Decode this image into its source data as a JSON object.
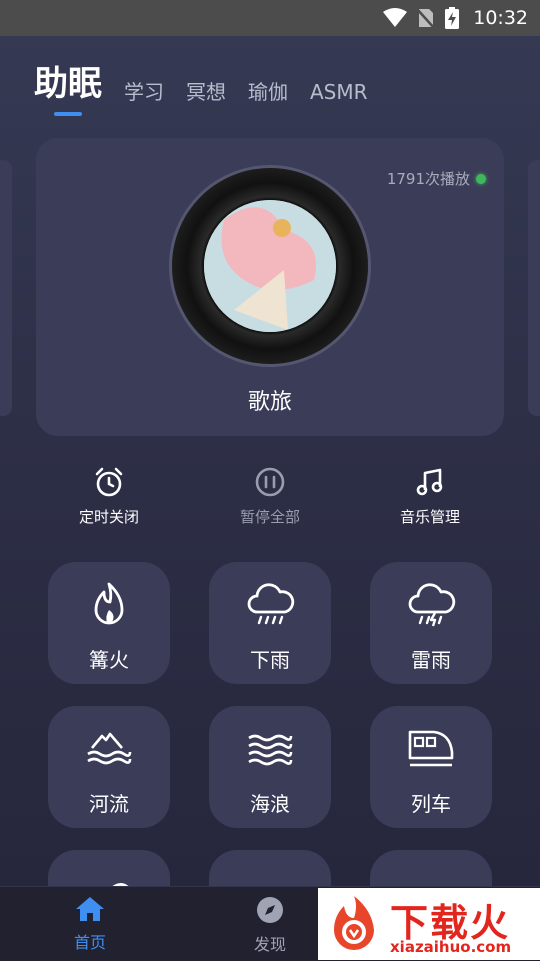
{
  "status": {
    "time": "10:32"
  },
  "tabs": [
    {
      "label": "助眠",
      "active": true
    },
    {
      "label": "学习"
    },
    {
      "label": "冥想"
    },
    {
      "label": "瑜伽"
    },
    {
      "label": "ASMR"
    }
  ],
  "player": {
    "plays": "1791次播放",
    "title": "歌旅"
  },
  "controls": [
    {
      "label": "定时关闭",
      "icon": "alarm-clock-icon"
    },
    {
      "label": "暂停全部",
      "icon": "pause-circle-icon"
    },
    {
      "label": "音乐管理",
      "icon": "music-note-icon"
    }
  ],
  "sounds": [
    {
      "label": "篝火",
      "icon": "fire-icon"
    },
    {
      "label": "下雨",
      "icon": "rain-cloud-icon"
    },
    {
      "label": "雷雨",
      "icon": "thunder-cloud-icon"
    },
    {
      "label": "河流",
      "icon": "river-icon"
    },
    {
      "label": "海浪",
      "icon": "waves-icon"
    },
    {
      "label": "列车",
      "icon": "train-icon"
    }
  ],
  "nav": [
    {
      "label": "首页",
      "icon": "home-icon",
      "active": true
    },
    {
      "label": "发现",
      "icon": "compass-icon"
    }
  ],
  "watermark": {
    "title": "下载火",
    "url": "xiazaihuo.com"
  },
  "colors": {
    "accent": "#3f8ff2",
    "card": "#3b3d58",
    "live": "#3fb85c"
  }
}
